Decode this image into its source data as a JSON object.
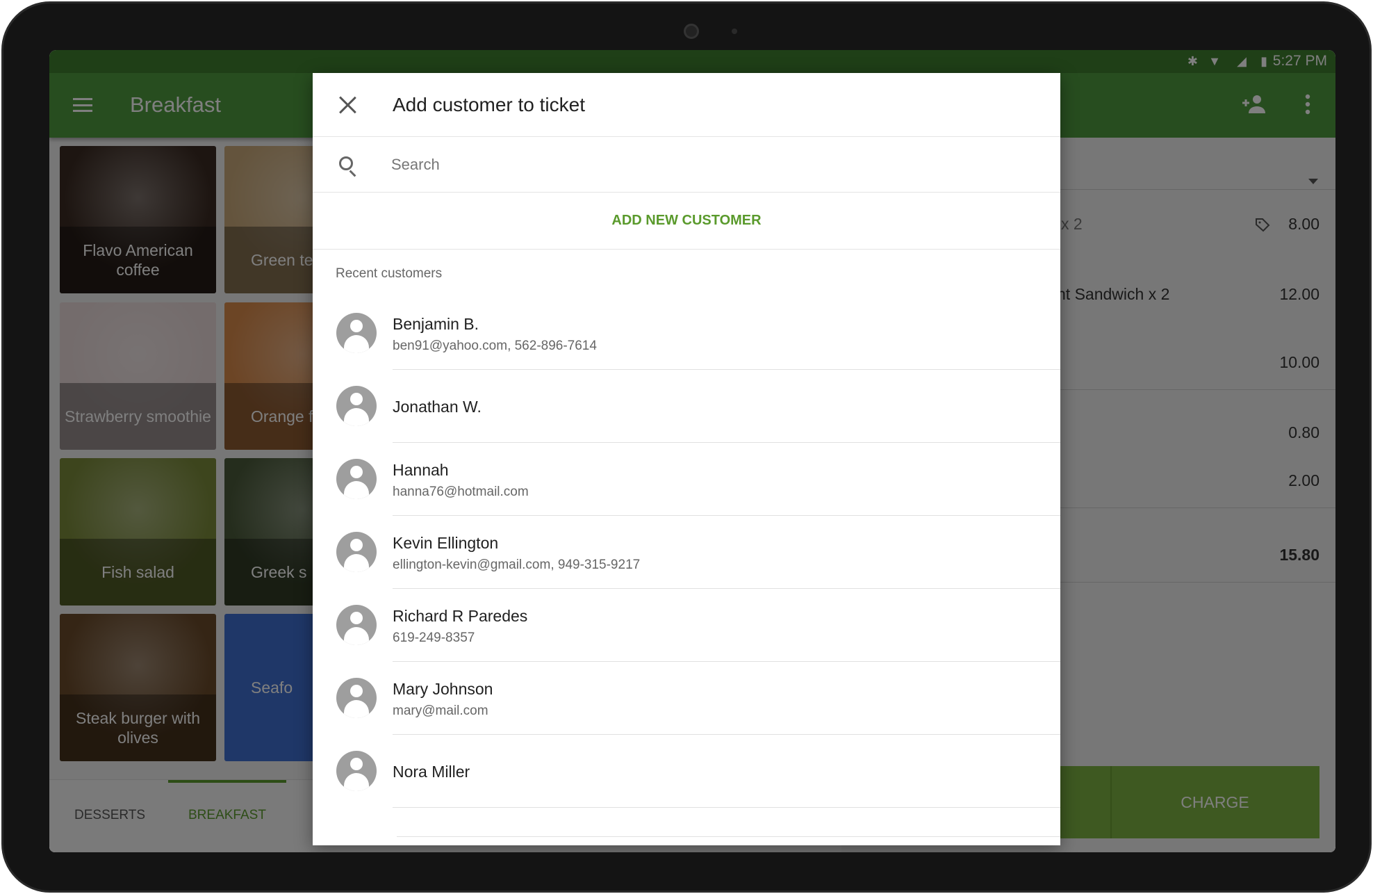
{
  "device": {
    "status_time": "5:27 PM"
  },
  "toolbar": {
    "title": "Breakfast"
  },
  "tiles": [
    {
      "label": "Flavo American coffee",
      "bg": "#3a2a22"
    },
    {
      "label": "Green tea jasmi",
      "bg": "#c9a97a"
    },
    {
      "label": "Strawberry smoothie",
      "bg": "#e8d8d8"
    },
    {
      "label": "Orange fres",
      "bg": "#d98a4a"
    },
    {
      "label": "Fish salad",
      "bg": "#7a8a3a"
    },
    {
      "label": "Greek s",
      "bg": "#4a5a3a"
    },
    {
      "label": "Steak burger with olives",
      "bg": "#6a4a2a"
    },
    {
      "label": "Seafo",
      "bg": "#3f6fd0"
    }
  ],
  "category_tabs": [
    {
      "label": "DESSERTS"
    },
    {
      "label": "BREAKFAST",
      "active": true
    }
  ],
  "ticket": {
    "items": [
      {
        "name": "x 2",
        "value": "8.00",
        "discount_icon": "tag-icon"
      },
      {
        "name": "nt Sandwich x 2",
        "value": "12.00"
      },
      {
        "name": "",
        "value": "10.00"
      }
    ],
    "subtotals": [
      "0.80",
      "2.00"
    ],
    "total": "15.80",
    "charge_label": "CHARGE"
  },
  "dialog": {
    "title": "Add customer to ticket",
    "search_placeholder": "Search",
    "search_value": "",
    "add_new_label": "ADD NEW CUSTOMER",
    "recent_label": "Recent customers",
    "customers": [
      {
        "name": "Benjamin B.",
        "detail": "ben91@yahoo.com, 562-896-7614"
      },
      {
        "name": "Jonathan W.",
        "detail": ""
      },
      {
        "name": "Hannah",
        "detail": "hanna76@hotmail.com"
      },
      {
        "name": "Kevin Ellington",
        "detail": "ellington-kevin@gmail.com, 949-315-9217"
      },
      {
        "name": "Richard R Paredes",
        "detail": "619-249-8357"
      },
      {
        "name": "Mary Johnson",
        "detail": "mary@mail.com"
      },
      {
        "name": "Nora Miller",
        "detail": ""
      }
    ]
  },
  "colors": {
    "accent": "#5a9a2c",
    "toolbar": "#4e9a3e",
    "charge": "#7cb342"
  }
}
